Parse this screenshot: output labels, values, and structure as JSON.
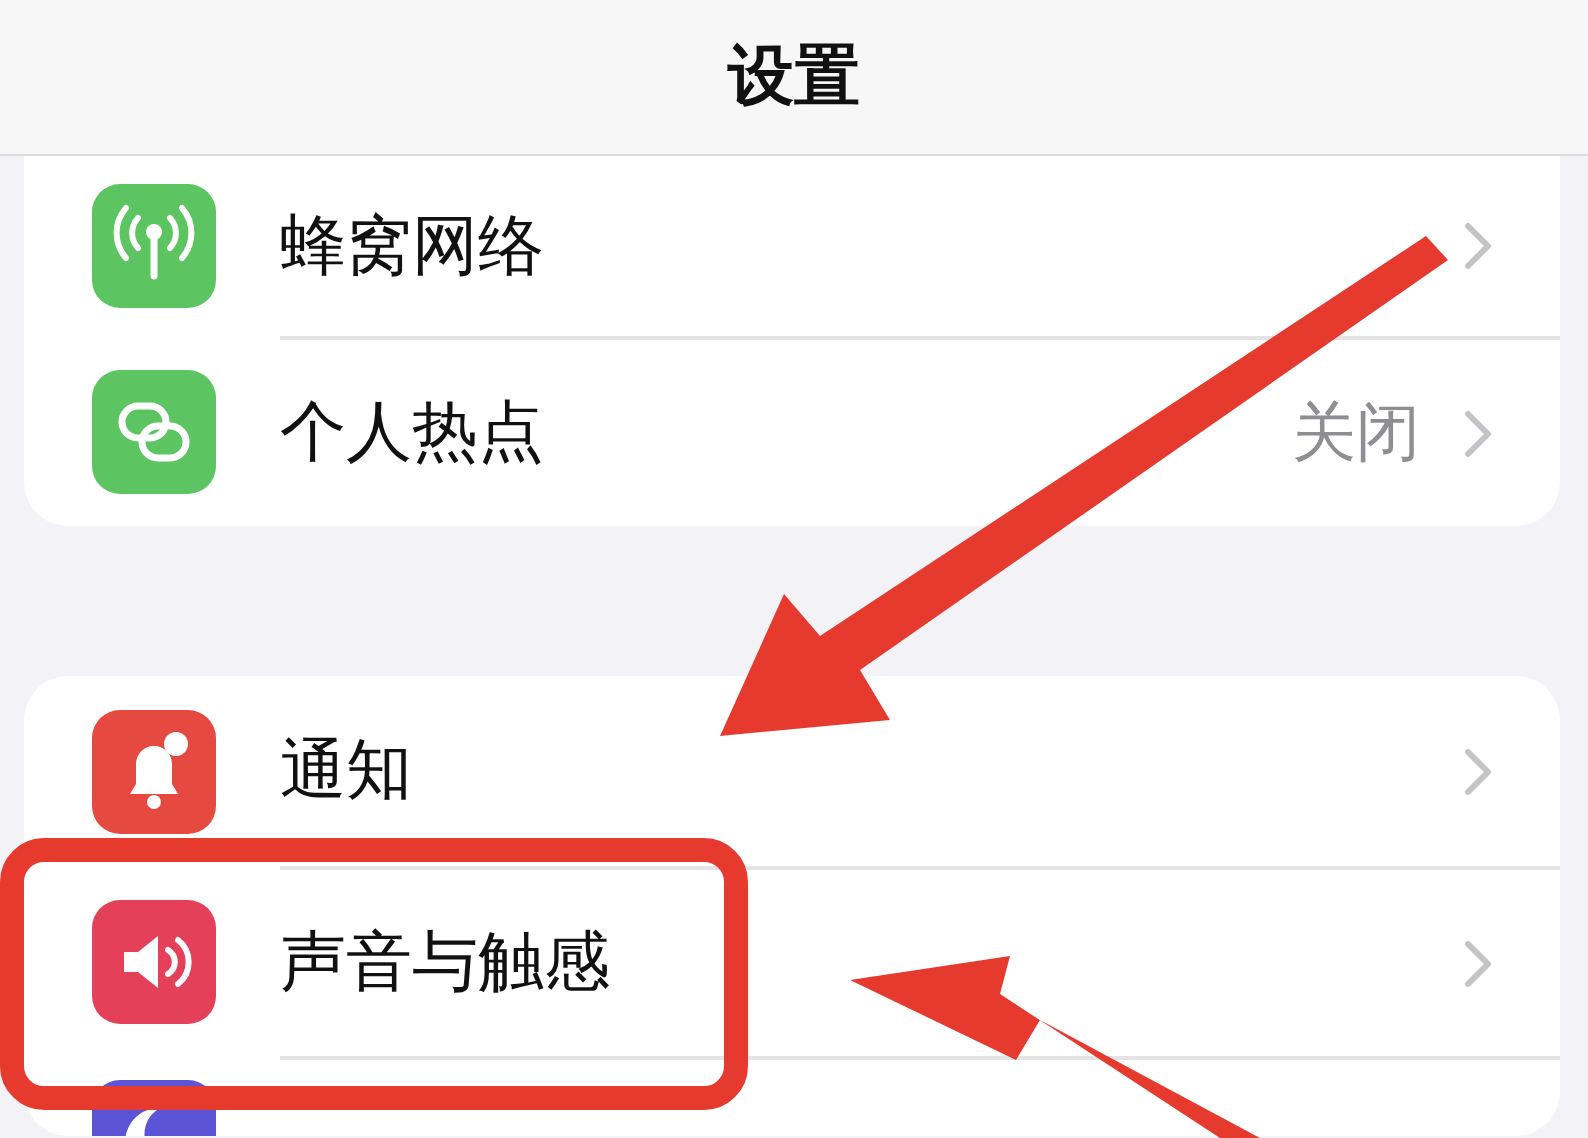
{
  "navigation_bar": {
    "title": "设置"
  },
  "groups": [
    {
      "items": [
        {
          "label": "蜂窝网络",
          "color": "#5cc461"
        },
        {
          "label": "个人热点",
          "value": "关闭",
          "color": "#5cc461"
        }
      ]
    },
    {
      "items": [
        {
          "label": "通知",
          "color": "#e5493f"
        },
        {
          "label": "声音与触感",
          "color": "#e4405a"
        },
        {
          "color": "#5b54d6"
        }
      ]
    }
  ]
}
